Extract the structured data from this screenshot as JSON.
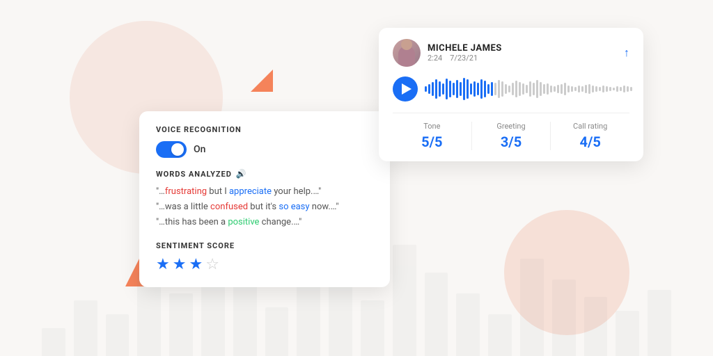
{
  "background": {
    "bars": [
      40,
      80,
      60,
      120,
      90,
      150,
      110,
      70,
      130,
      100,
      80,
      160,
      120,
      90,
      60,
      140,
      110,
      85,
      65,
      95
    ]
  },
  "voice_card": {
    "title": "VOICE RECOGNITION",
    "toggle_state": "On",
    "words_analyzed_title": "WORDS ANALYZED",
    "lines": [
      {
        "text_before": "\"…",
        "word1": "frustrating",
        "word1_class": "word-red",
        "text_mid": " but I ",
        "word2": "appreciate",
        "word2_class": "word-blue",
        "text_after": " your help.…\""
      },
      {
        "text_before": "\"…was a little ",
        "word1": "confused",
        "word1_class": "word-red",
        "text_mid": " but it's ",
        "word2": "so easy",
        "word2_class": "word-blue",
        "text_after": " now.…\""
      },
      {
        "text_before": "\"…this has been a ",
        "word1": "positive",
        "word1_class": "word-green",
        "text_mid": " change.…\"",
        "word2": "",
        "word2_class": "",
        "text_after": ""
      }
    ],
    "sentiment_title": "SENTIMENT SCORE",
    "stars_filled": 3,
    "stars_empty": 1,
    "stars_total": 4
  },
  "audio_card": {
    "user_name": "MICHELE JAMES",
    "user_time": "2:24",
    "user_date": "7/23/21",
    "metrics": [
      {
        "label": "Tone",
        "value": "5/5"
      },
      {
        "label": "Greeting",
        "value": "3/5"
      },
      {
        "label": "Call rating",
        "value": "4/5"
      }
    ],
    "share_icon": "↑",
    "play_icon": "▶"
  }
}
